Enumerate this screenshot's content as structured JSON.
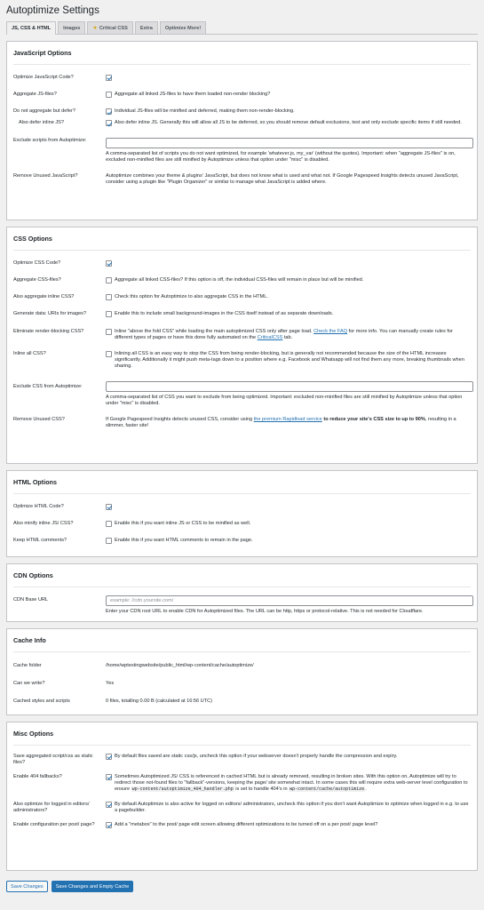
{
  "page_title": "Autoptimize Settings",
  "tabs": [
    {
      "label": "JS, CSS & HTML"
    },
    {
      "label": "Images"
    },
    {
      "label": "Critical CSS"
    },
    {
      "label": "Extra"
    },
    {
      "label": "Optimize More!"
    }
  ],
  "js": {
    "title": "JavaScript Options",
    "optimize_label": "Optimize JavaScript Code?",
    "aggregate_label": "Aggregate JS-files?",
    "aggregate_desc": "Aggregate all linked JS-files to have them loaded non-render blocking?",
    "defer_label": "Do not aggregate but defer?",
    "defer_desc": "Individual JS-files will be minified and deferred, making them non-render-blocking.",
    "inline_defer_label": "Also defer inline JS?",
    "inline_defer_desc": "Also defer inline JS. Generally this will allow all JS to be deferred, so you should remove default exclusions, test and only exclude specific items if still needed.",
    "exclude_label": "Exclude scripts from Autoptimize:",
    "exclude_value": "",
    "exclude_desc": "A comma-separated list of scripts you do not want optimized, for example 'whatever.js, my_var' (without the quotes). Important: when \"aggregate JS-files\" is on, excluded non-minified files are still minified by Autoptimize unless that option under \"misc\" is disabled.",
    "unused_label": "Remove Unused JavaScript?",
    "unused_desc": "Autoptimize combines your theme & plugins' JavaScript, but does not know what is used and what not. If Google Pagespeed Insights detects unused JavaScript, consider using a plugin like \"Plugin Organizer\" or similar to manage what JavaScript is added where."
  },
  "css": {
    "title": "CSS Options",
    "optimize_label": "Optimize CSS Code?",
    "aggregate_label": "Aggregate CSS-files?",
    "aggregate_desc": "Aggregate all linked CSS-files? If this option is off, the individual CSS-files will remain in place but will be minified.",
    "inline_label": "Also aggregate inline CSS?",
    "inline_desc": "Check this option for Autoptimize to also aggregate CSS in the HTML.",
    "datauri_label": "Generate data: URIs for images?",
    "datauri_desc": "Enable this to include small background-images in the CSS itself instead of as separate downloads.",
    "renderblock_label": "Eliminate render-blocking CSS?",
    "renderblock_desc_1": "Inline \"above the fold CSS\" while loading the main autoptimized CSS only after page load.",
    "renderblock_link_1": "Check the FAQ",
    "renderblock_desc_2": "for more info. You can manually create rules for different types of pages or have this done fully automated on the",
    "renderblock_link_2": "CriticalCSS",
    "renderblock_desc_3": "tab.",
    "inlineall_label": "Inline all CSS?",
    "inlineall_desc": "Inlining all CSS is an easy way to stop the CSS from being render-blocking, but is generally not recommended because the size of the HTML increases significantly. Additionally it might push meta-tags down to a position where e.g. Facebook and Whatsapp will not find them any more, breaking thumbnails when sharing.",
    "exclude_label": "Exclude CSS from Autoptimize:",
    "exclude_value": "",
    "exclude_desc": "A comma-separated list of CSS you want to exclude from being optimized. Important: excluded non-minified files are still minified by Autoptimize unless that option under \"misc\" is disabled.",
    "unused_label": "Remove Unused CSS?",
    "unused_desc_1": "If Google Pagespeed Insights detects unused CSS, consider using",
    "unused_link": "the premium Rapidload service",
    "unused_desc_2": "to reduce your site's CSS size to up to 90%",
    "unused_desc_3": ", resulting in a slimmer, faster site!"
  },
  "html": {
    "title": "HTML Options",
    "optimize_label": "Optimize HTML Code?",
    "minify_inline_label": "Also minify inline JS/ CSS?",
    "minify_inline_desc": "Enable this if you want inline JS or CSS to be minified as well.",
    "comments_label": "Keep HTML comments?",
    "comments_desc": "Enable this if you want HTML comments to remain in the page."
  },
  "cdn": {
    "title": "CDN Options",
    "base_label": "CDN Base URL",
    "base_placeholder": "example: //cdn.yoursite.com/",
    "base_desc": "Enter your CDN root URL to enable CDN for Autoptimized files. The URL can be http, https or protocol-relative. This is not needed for Cloudflare."
  },
  "cache": {
    "title": "Cache Info",
    "folder_label": "Cache folder",
    "folder_value": "/home/wptestingwebsite/public_html/wp-content/cache/autoptimize/",
    "write_label": "Can we write?",
    "write_value": "Yes",
    "cached_label": "Cached styles and scripts",
    "cached_value": "0 files, totalling 0.00 B (calculated at 16:56 UTC)"
  },
  "misc": {
    "title": "Misc Options",
    "static_label": "Save aggregated script/css as static files?",
    "static_desc": "By default files saved are static css/js, uncheck this option if your webserver doesn't properly handle the compression and expiry.",
    "fallback_label": "Enable 404 fallbacks?",
    "fallback_desc_1": "Sometimes Autoptimized JS/ CSS is referenced in cached HTML but is already removed, resulting in broken sites. With this option on, Autoptimize will try to redirect those not-found files to \"fallback\"-versions, keeping the page/ site somewhat intact. In some cases this will require extra web-server level configuration to ensure",
    "fallback_code_1": "wp-content/autoptimize_404_handler.php",
    "fallback_desc_2": "is set to handle 404's in",
    "fallback_code_2": "wp-content/cache/autoptimize",
    "fallback_desc_3": ".",
    "loggedin_label": "Also optimize for logged in editors/ administrators?",
    "loggedin_desc": "By default Autoptimize is also active for logged on editors/ administrators, uncheck this option if you don't want Autoptimize to optimize when logged in e.g. to use a pagebuilder.",
    "metabox_label": "Enable configuration per post/ page?",
    "metabox_desc": "Add a \"metabox\" to the post/ page edit screen allowing different optimizations to be turned off on a per post/ page level?"
  },
  "buttons": {
    "save": "Save Changes",
    "save_empty": "Save Changes and Empty Cache"
  }
}
